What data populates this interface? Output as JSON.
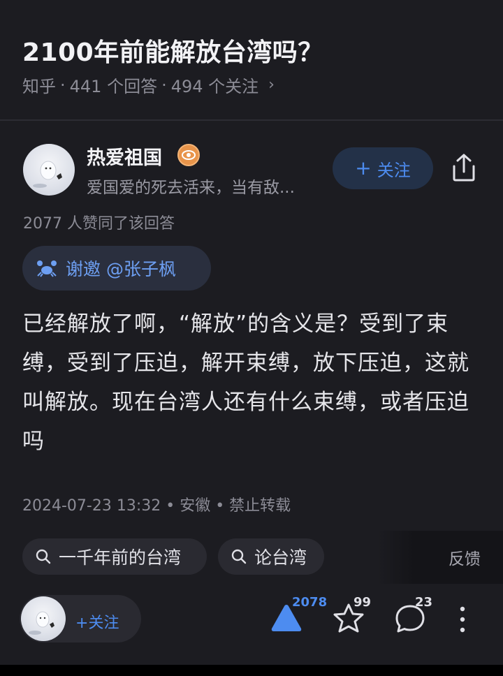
{
  "question": {
    "title": "2100年前能解放台湾吗？",
    "source": "知乎",
    "answers": "441 个回答",
    "followers": "494 个关注",
    "chevron": "›"
  },
  "author": {
    "name": "热爱祖国",
    "bio": "爱国爱的死去活来，当有敌...",
    "follow_label": "关注",
    "badge_icon": "eye-badge-icon",
    "badge_color": "#e8944a"
  },
  "agree_text": "2077 人赞同了该回答",
  "invite": {
    "label": "谢邀 @张子枫",
    "icon": "crab-icon"
  },
  "answer": {
    "body": "已经解放了啊，“解放”的含义是？受到了束缚，受到了压迫，解开束缚，放下压迫，这就叫解放。现在台湾人还有什么束缚，或者压迫吗",
    "meta": "2024-07-23 13:32 • 安徽 • 禁止转载"
  },
  "tags": [
    {
      "label": "一千年前的台湾",
      "icon": "search-icon"
    },
    {
      "label": "论台湾",
      "icon": "search-icon"
    }
  ],
  "feedback_label": "反馈",
  "bottom_bar": {
    "follow_label": "关注",
    "upvote_count": "2078",
    "star_count": "99",
    "comment_count": "23"
  },
  "colors": {
    "background": "#1c1c21",
    "accent": "#4d8cf0"
  }
}
